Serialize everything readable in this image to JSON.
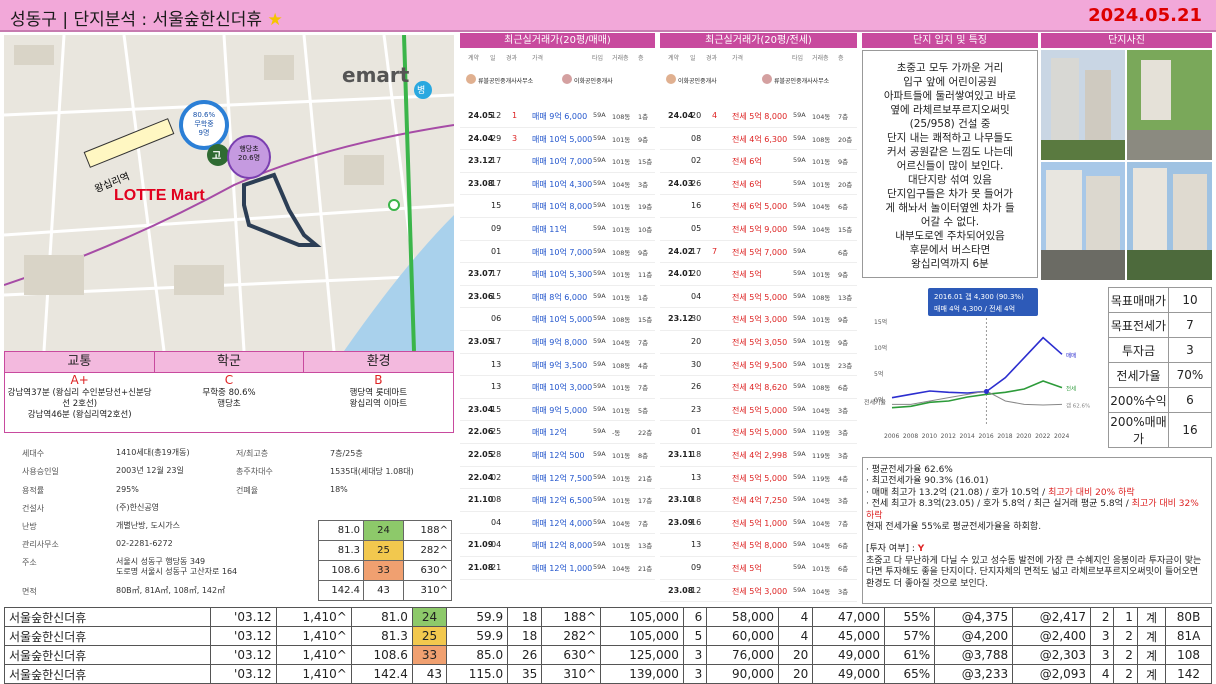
{
  "header": {
    "title": "성동구 | 단지분석 : 서울숲한신더휴",
    "star": "★",
    "date": "2024.05.21"
  },
  "map": {
    "labels": {
      "emart": "emart",
      "lotte": "LOTTE Mart",
      "school1": "80.6%\n무학중\n9명",
      "school2": "행당초\n20.6명",
      "line": "왕십리역",
      "hosp": "병",
      "go": "고"
    }
  },
  "grades": {
    "heads": [
      "교통",
      "학군",
      "환경"
    ],
    "values": [
      "A+",
      "C",
      "B"
    ],
    "descs": [
      "강남역37분 (왕십리 수인분당선+신분당선 2호선)\n강남역46분 (왕십리역2호선)",
      "무학중 80.6%\n행당초",
      "행당역 롯데마트\n왕십리역 이마트"
    ]
  },
  "info": {
    "rows": [
      {
        "k1": "세대수",
        "v1": "1410세대(총19개동)",
        "k2": "저/최고층",
        "v2": "7층/25층"
      },
      {
        "k1": "사용승인일",
        "v1": "2003년 12월 23일",
        "k2": "총주차대수",
        "v2": "1535대(세대당 1.08대)"
      },
      {
        "k1": "용적률",
        "v1": "295%",
        "k2": "건폐율",
        "v2": "18%"
      },
      {
        "k1": "건설사",
        "v1": "(주)한신공영",
        "k2": "",
        "v2": ""
      },
      {
        "k1": "난방",
        "v1": "개별난방, 도시가스",
        "k2": "",
        "v2": ""
      },
      {
        "k1": "관리사무소",
        "v1": "02-2281-6272",
        "k2": "",
        "v2": ""
      },
      {
        "k1": "주소",
        "v1": "서울시 성동구 행당동 349\n도로명 서울시 성동구 고산자로 164",
        "k2": "",
        "v2": ""
      },
      {
        "k1": "면적",
        "v1": "80B㎡, 81A㎡, 108㎡, 142㎡",
        "k2": "",
        "v2": ""
      }
    ]
  },
  "mini": [
    [
      "81.0",
      "24",
      "188^"
    ],
    [
      "81.3",
      "25",
      "282^"
    ],
    [
      "108.6",
      "33",
      "630^"
    ],
    [
      "142.4",
      "43",
      "310^"
    ]
  ],
  "sale": {
    "title": "최근실거래가(20평/매매)",
    "cols": [
      "계약",
      "일",
      "경과",
      "가격",
      "타입",
      "거래층",
      "층"
    ],
    "rows": [
      [
        "24.05",
        "12",
        "1",
        "매매 9억 6,000",
        "59A",
        "108동",
        "1층"
      ],
      [
        "24.04",
        "29",
        "3",
        "매매 10억 5,000",
        "59A",
        "101동",
        "9층"
      ],
      [
        "23.12",
        "17",
        "",
        "매매 10억 7,000",
        "59A",
        "101동",
        "15층"
      ],
      [
        "23.08",
        "17",
        "",
        "매매 10억 4,300",
        "59A",
        "104동",
        "3층"
      ],
      [
        "",
        "15",
        "",
        "매매 10억 8,000",
        "59A",
        "101동",
        "19층"
      ],
      [
        "",
        "09",
        "",
        "매매 11억",
        "59A",
        "101동",
        "10층"
      ],
      [
        "",
        "01",
        "",
        "매매 10억 7,000",
        "59A",
        "108동",
        "9층"
      ],
      [
        "23.07",
        "17",
        "",
        "매매 10억 5,300",
        "59A",
        "101동",
        "11층"
      ],
      [
        "23.06",
        "15",
        "",
        "매매 8억 6,000",
        "59A",
        "101동",
        "1층"
      ],
      [
        "",
        "06",
        "",
        "매매 10억 5,000",
        "59A",
        "108동",
        "15층"
      ],
      [
        "23.05",
        "17",
        "",
        "매매 9억 8,000",
        "59A",
        "104동",
        "7층"
      ],
      [
        "",
        "13",
        "",
        "매매 9억 3,500",
        "59A",
        "108동",
        "4층"
      ],
      [
        "",
        "13",
        "",
        "매매 10억 3,000",
        "59A",
        "101동",
        "7층"
      ],
      [
        "23.04",
        "15",
        "",
        "매매 9억 5,000",
        "59A",
        "101동",
        "5층"
      ],
      [
        "22.06",
        "25",
        "",
        "매매 12억",
        "59A",
        "-동",
        "22층"
      ],
      [
        "22.05",
        "28",
        "",
        "매매 12억 500",
        "59A",
        "101동",
        "8층"
      ],
      [
        "22.04",
        "02",
        "",
        "매매 12억 7,500",
        "59A",
        "101동",
        "21층"
      ],
      [
        "21.10",
        "08",
        "",
        "매매 12억 6,500",
        "59A",
        "101동",
        "17층"
      ],
      [
        "",
        "04",
        "",
        "매매 12억 4,000",
        "59A",
        "104동",
        "7층"
      ],
      [
        "21.09",
        "04",
        "",
        "매매 12억 8,000",
        "59A",
        "101동",
        "13층"
      ],
      [
        "21.08",
        "21",
        "",
        "매매 12억 1,000",
        "59A",
        "104동",
        "21층"
      ]
    ]
  },
  "rent": {
    "title": "최근실거래가(20평/전세)",
    "cols": [
      "계약",
      "일",
      "경과",
      "가격",
      "타입",
      "거래층",
      "층"
    ],
    "rows": [
      [
        "24.04",
        "20",
        "4",
        "전세 5억 8,000",
        "59A",
        "104동",
        "7층"
      ],
      [
        "",
        "08",
        "",
        "전세 4억 6,300",
        "59A",
        "108동",
        "20층"
      ],
      [
        "",
        "02",
        "",
        "전세 6억",
        "59A",
        "101동",
        "9층"
      ],
      [
        "24.03",
        "26",
        "",
        "전세 6억",
        "59A",
        "101동",
        "20층"
      ],
      [
        "",
        "16",
        "",
        "전세 6억 5,000",
        "59A",
        "104동",
        "6층"
      ],
      [
        "",
        "05",
        "",
        "전세 5억 9,000",
        "59A",
        "104동",
        "15층"
      ],
      [
        "24.02",
        "17",
        "7",
        "전세 5억 7,000",
        "59A",
        "",
        "6층"
      ],
      [
        "24.01",
        "20",
        "",
        "전세 5억",
        "59A",
        "101동",
        "9층"
      ],
      [
        "",
        "04",
        "",
        "전세 5억 5,000",
        "59A",
        "108동",
        "13층"
      ],
      [
        "23.12",
        "30",
        "",
        "전세 5억 3,000",
        "59A",
        "101동",
        "9층"
      ],
      [
        "",
        "20",
        "",
        "전세 5억 3,050",
        "59A",
        "101동",
        "9층"
      ],
      [
        "",
        "30",
        "",
        "전세 5억 9,500",
        "59A",
        "101동",
        "23층"
      ],
      [
        "",
        "26",
        "",
        "전세 4억 8,620",
        "59A",
        "108동",
        "6층"
      ],
      [
        "",
        "23",
        "",
        "전세 5억 5,000",
        "59A",
        "104동",
        "3층"
      ],
      [
        "",
        "01",
        "",
        "전세 5억 5,000",
        "59A",
        "119동",
        "3층"
      ],
      [
        "23.11",
        "18",
        "",
        "전세 4억 2,998",
        "59A",
        "119동",
        "3층"
      ],
      [
        "",
        "13",
        "",
        "전세 5억 5,000",
        "59A",
        "119동",
        "4층"
      ],
      [
        "23.10",
        "18",
        "",
        "전세 4억 7,250",
        "59A",
        "104동",
        "3층"
      ],
      [
        "23.09",
        "16",
        "",
        "전세 5억 1,000",
        "59A",
        "104동",
        "7층"
      ],
      [
        "",
        "13",
        "",
        "전세 5억 8,000",
        "59A",
        "104동",
        "6층"
      ],
      [
        "",
        "09",
        "",
        "전세 5억",
        "59A",
        "101동",
        "6층"
      ],
      [
        "23.08",
        "12",
        "",
        "전세 5억 3,000",
        "59A",
        "104동",
        "3층"
      ]
    ]
  },
  "agents": {
    "a1": "류블공인중개사사무소",
    "a2": "이화공인중개사",
    "a3": "이화공인중개사",
    "a4": "류블공인중개사사무소"
  },
  "location": {
    "title": "단지 입지 및 특징",
    "text": "초중고 모두 가까운 거리\n입구 앞에 어린이공원\n아파트들에 둘러쌓여있고 바로\n옆에 라체르보푸르지오써밋\n(25/958) 건설 중\n단지 내는 쾌적하고 나무들도\n커서 공원같은 느낌도 나는데\n어르신들이 많이 보인다.\n대단지랑 섞여 있음\n단지입구들은 차가 못 들어가\n게 해놔서 놀이터옆엔 차가 들\n어갈 수 없다.\n내부도로엔 주차되어있음\n후문에서 버스타면\n왕십리역까지 6분"
  },
  "photos": {
    "title": "단지사진"
  },
  "chart_data": {
    "type": "line",
    "tooltip": [
      "2016.01 갭 4,300 (90.3%)",
      "매매 4억 4,300 / 전세 4억"
    ],
    "x": [
      2006,
      2008,
      2010,
      2012,
      2014,
      2016,
      2018,
      2020,
      2022,
      2024
    ],
    "ylabels": [
      "15억",
      "10억",
      "5억",
      "0억"
    ],
    "series": [
      {
        "name": "매매",
        "values": [
          3.5,
          4,
          4.5,
          4.3,
          4.2,
          4.43,
          6.5,
          9.5,
          12.5,
          10
        ]
      },
      {
        "name": "전세",
        "values": [
          2,
          2.2,
          2.8,
          3,
          3.6,
          4,
          4.3,
          4.8,
          6,
          5
        ]
      },
      {
        "name": "전세가율",
        "values": [
          0.5,
          0.5,
          0.6,
          0.7,
          0.8,
          0.9,
          0.6,
          0.5,
          0.48,
          0.5
        ]
      }
    ],
    "rlabels": [
      "매매",
      "전세",
      "갭\n62.6%"
    ],
    "ylabel2": "전세가율"
  },
  "target": [
    [
      "목표매매가",
      "10"
    ],
    [
      "목표전세가",
      "7"
    ],
    [
      "투자금",
      "3"
    ],
    [
      "전세가율",
      "70%"
    ],
    [
      "200%수익",
      "6"
    ],
    [
      "200%매매가",
      "16"
    ]
  ],
  "notes": {
    "l1": "· 평균전세가율 62.6%",
    "l2": "· 최고전세가율 90.3% (16.01)",
    "l3": "· 매매 최고가 13.2억 (21.08) / 호가 10.5억 / ",
    "l3r": "최고가 대비 20% 하락",
    "l4": "· 전세 최고가 8.3억(23.05) / 호가 5.8억 / 최근 실거래 평균 5.8억 / ",
    "l4r": "최고가 대비 32% 하락",
    "l5": "현재 전세가율 55%로 평균전세가율을 하회함.",
    "l6": "[투자 여부] : ",
    "l6r": "Y",
    "l7": "초중고 다 무난하게 다닐 수 있고 성수동 발전에 가장 큰 수혜지인 응봉이라 투자금이 맞는다면 투자해도 좋을 단지이다. 단지자체의 면적도 넓고 라체르보푸르지오써밋이 들어오면 환경도 더 좋아질 것으로 보인다."
  },
  "bottom": [
    [
      "서울숲한신더휴",
      "'03.12",
      "1,410^",
      "81.0",
      "24",
      "59.9",
      "18",
      "188^",
      "105,000",
      "6",
      "58,000",
      "4",
      "47,000",
      "55%",
      "@4,375",
      "@2,417",
      "2",
      "1",
      "계",
      "80B"
    ],
    [
      "서울숲한신더휴",
      "'03.12",
      "1,410^",
      "81.3",
      "25",
      "59.9",
      "18",
      "282^",
      "105,000",
      "5",
      "60,000",
      "4",
      "45,000",
      "57%",
      "@4,200",
      "@2,400",
      "3",
      "2",
      "계",
      "81A"
    ],
    [
      "서울숲한신더휴",
      "'03.12",
      "1,410^",
      "108.6",
      "33",
      "85.0",
      "26",
      "630^",
      "125,000",
      "3",
      "76,000",
      "20",
      "49,000",
      "61%",
      "@3,788",
      "@2,303",
      "3",
      "2",
      "계",
      "108"
    ],
    [
      "서울숲한신더휴",
      "'03.12",
      "1,410^",
      "142.4",
      "43",
      "115.0",
      "35",
      "310^",
      "139,000",
      "3",
      "90,000",
      "20",
      "49,000",
      "65%",
      "@3,233",
      "@2,093",
      "4",
      "2",
      "계",
      "142"
    ]
  ],
  "colors": {
    "c24": "#8dc96a",
    "c25": "#f2c84e",
    "c33": "#f0a070",
    "c43": "#ffffff"
  }
}
